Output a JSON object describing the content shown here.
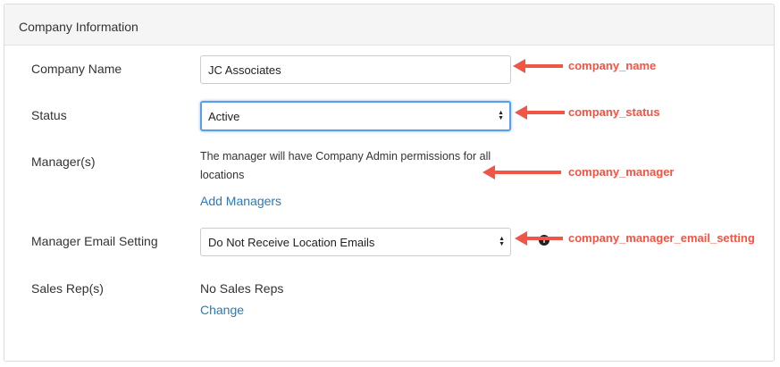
{
  "panel": {
    "title": "Company Information"
  },
  "fields": {
    "company_name": {
      "label": "Company Name",
      "value": "JC Associates"
    },
    "status": {
      "label": "Status",
      "selected": "Active"
    },
    "managers": {
      "label": "Manager(s)",
      "note": "The manager will have Company Admin permissions for all locations",
      "add_link": "Add Managers"
    },
    "manager_email_setting": {
      "label": "Manager Email Setting",
      "selected": "Do Not Receive Location Emails",
      "info_icon": "info-icon"
    },
    "sales_reps": {
      "label": "Sales Rep(s)",
      "value": "No Sales Reps",
      "change_link": "Change"
    }
  },
  "annotations": {
    "color": "#f05545",
    "company_name": "company_name",
    "company_status": "company_status",
    "company_manager": "company_manager",
    "company_manager_email_setting": "company_manager_email_setting"
  }
}
